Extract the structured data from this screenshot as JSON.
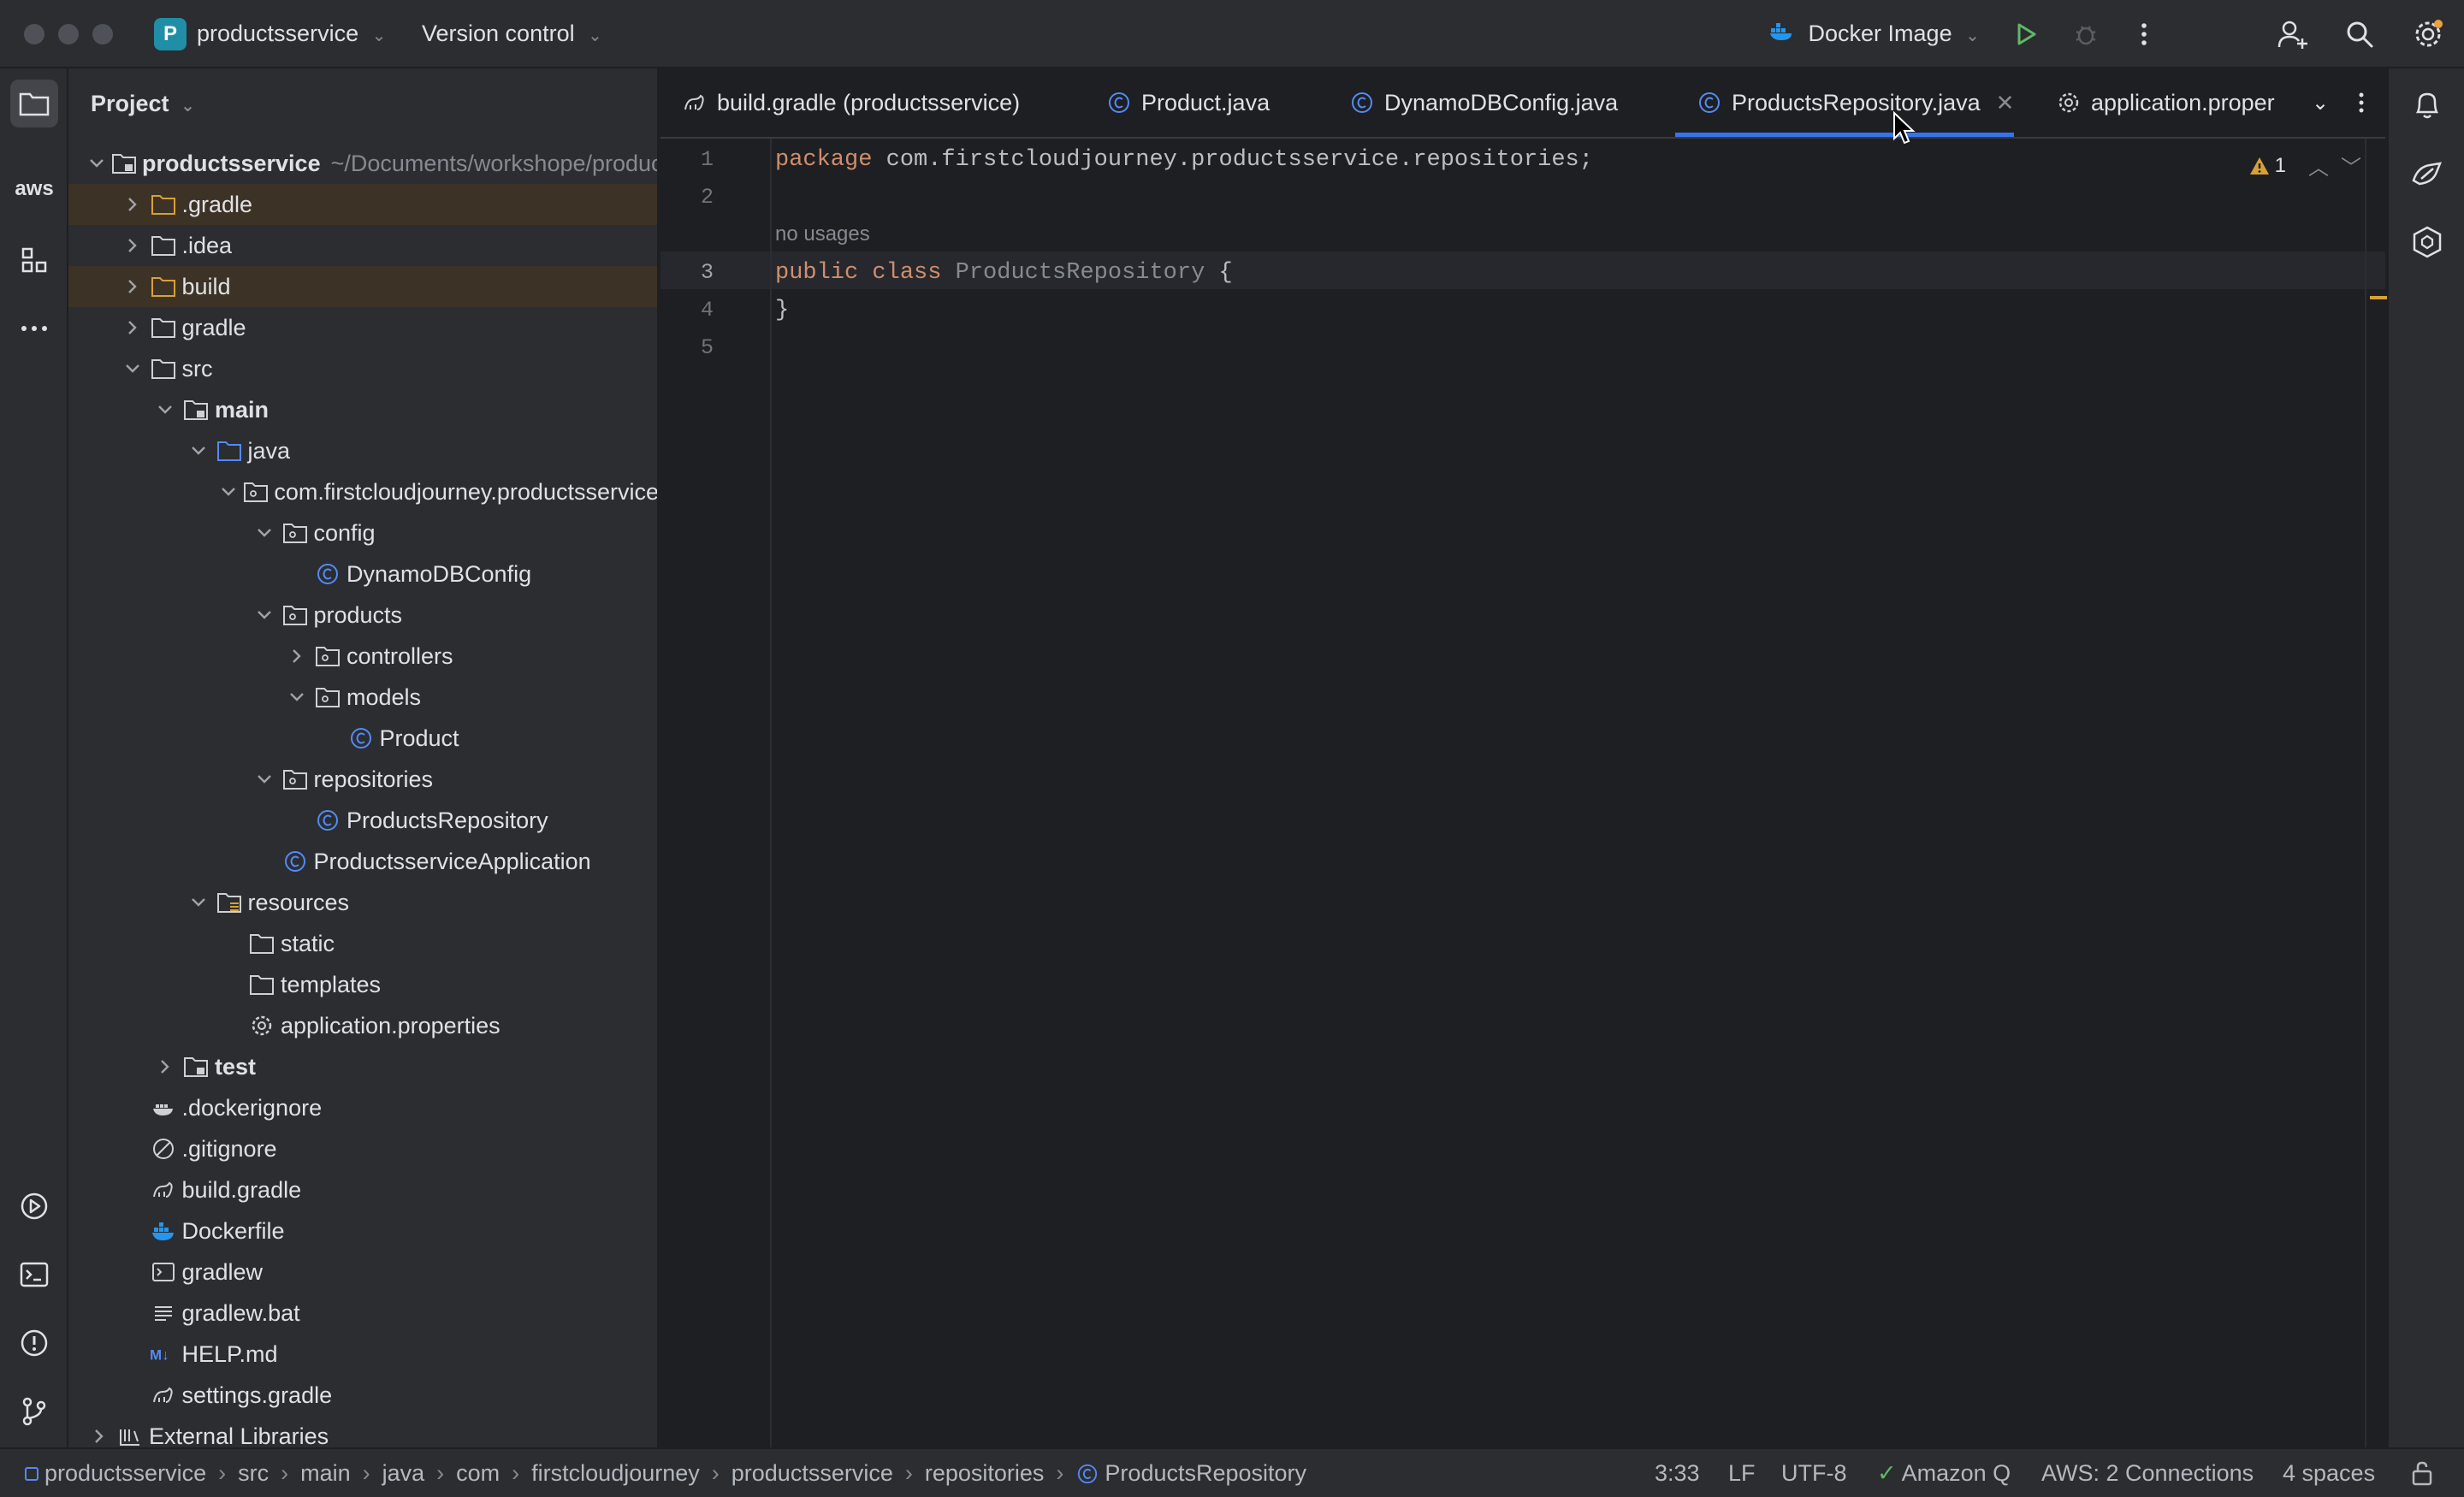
{
  "titlebar": {
    "project_badge": "P",
    "project_name": "productsservice",
    "vcs_label": "Version control",
    "run_config": "Docker Image"
  },
  "left_strip": [
    "folder-icon",
    "aws-icon",
    "structure-icon",
    "more-icon",
    "run-icon",
    "terminal-icon",
    "problems-icon",
    "git-icon"
  ],
  "left_strip_aws_label": "aws",
  "project_panel": {
    "title": "Project",
    "tree": [
      {
        "label": "productsservice",
        "hint": "~/Documents/workshope/products",
        "indent": 0,
        "chev": "down",
        "icon": "module-folder",
        "bold": true,
        "excluded": false
      },
      {
        "label": ".gradle",
        "indent": 1,
        "chev": "right",
        "icon": "folder-excluded",
        "excluded": true
      },
      {
        "label": ".idea",
        "indent": 1,
        "chev": "right",
        "icon": "folder",
        "excluded": false
      },
      {
        "label": "build",
        "indent": 1,
        "chev": "right",
        "icon": "folder-excluded",
        "excluded": true
      },
      {
        "label": "gradle",
        "indent": 1,
        "chev": "right",
        "icon": "folder",
        "excluded": false
      },
      {
        "label": "src",
        "indent": 1,
        "chev": "down",
        "icon": "folder",
        "excluded": false
      },
      {
        "label": "main",
        "indent": 2,
        "chev": "down",
        "icon": "module-folder",
        "bold": true,
        "excluded": false
      },
      {
        "label": "java",
        "indent": 3,
        "chev": "down",
        "icon": "source-folder",
        "excluded": false
      },
      {
        "label": "com.firstcloudjourney.productsservice",
        "indent": 4,
        "chev": "down",
        "icon": "package",
        "excluded": false
      },
      {
        "label": "config",
        "indent": 5,
        "chev": "down",
        "icon": "package",
        "excluded": false
      },
      {
        "label": "DynamoDBConfig",
        "indent": 6,
        "chev": "none",
        "icon": "class",
        "excluded": false
      },
      {
        "label": "products",
        "indent": 5,
        "chev": "down",
        "icon": "package",
        "excluded": false
      },
      {
        "label": "controllers",
        "indent": 6,
        "chev": "right",
        "icon": "package",
        "excluded": false
      },
      {
        "label": "models",
        "indent": 6,
        "chev": "down",
        "icon": "package",
        "excluded": false
      },
      {
        "label": "Product",
        "indent": 7,
        "chev": "none",
        "icon": "class",
        "excluded": false
      },
      {
        "label": "repositories",
        "indent": 5,
        "chev": "down",
        "icon": "package",
        "excluded": false
      },
      {
        "label": "ProductsRepository",
        "indent": 6,
        "chev": "none",
        "icon": "class",
        "excluded": false
      },
      {
        "label": "ProductsserviceApplication",
        "indent": 5,
        "chev": "none",
        "icon": "class",
        "excluded": false
      },
      {
        "label": "resources",
        "indent": 3,
        "chev": "down",
        "icon": "resources-folder",
        "excluded": false
      },
      {
        "label": "static",
        "indent": 4,
        "chev": "none",
        "icon": "folder",
        "excluded": false
      },
      {
        "label": "templates",
        "indent": 4,
        "chev": "none",
        "icon": "folder",
        "excluded": false
      },
      {
        "label": "application.properties",
        "indent": 4,
        "chev": "none",
        "icon": "gear",
        "excluded": false
      },
      {
        "label": "test",
        "indent": 2,
        "chev": "right",
        "icon": "module-folder",
        "bold": true,
        "excluded": false
      },
      {
        "label": ".dockerignore",
        "indent": 1,
        "chev": "none",
        "icon": "docker-gray",
        "excluded": false
      },
      {
        "label": ".gitignore",
        "indent": 1,
        "chev": "none",
        "icon": "ignore",
        "excluded": false
      },
      {
        "label": "build.gradle",
        "indent": 1,
        "chev": "none",
        "icon": "gradle",
        "excluded": false
      },
      {
        "label": "Dockerfile",
        "indent": 1,
        "chev": "none",
        "icon": "docker",
        "excluded": false
      },
      {
        "label": "gradlew",
        "indent": 1,
        "chev": "none",
        "icon": "shell",
        "excluded": false
      },
      {
        "label": "gradlew.bat",
        "indent": 1,
        "chev": "none",
        "icon": "text",
        "excluded": false
      },
      {
        "label": "HELP.md",
        "indent": 1,
        "chev": "none",
        "icon": "markdown",
        "excluded": false
      },
      {
        "label": "settings.gradle",
        "indent": 1,
        "chev": "none",
        "icon": "gradle",
        "excluded": false
      },
      {
        "label": "External Libraries",
        "indent": 0,
        "chev": "right",
        "icon": "library",
        "excluded": false
      }
    ]
  },
  "tabs": [
    {
      "label": "build.gradle (productsservice)",
      "icon": "gradle",
      "active": false
    },
    {
      "label": "Product.java",
      "icon": "class",
      "active": false
    },
    {
      "label": "DynamoDBConfig.java",
      "icon": "class",
      "active": false
    },
    {
      "label": "ProductsRepository.java",
      "icon": "class",
      "active": true
    },
    {
      "label": "application.proper",
      "icon": "gear",
      "active": false
    }
  ],
  "editor": {
    "line_numbers": [
      "1",
      "2",
      "3",
      "4",
      "5"
    ],
    "package_kw": "package",
    "package_name": " com.firstcloudjourney.productsservice.repositories;",
    "usage_hint": "no usages",
    "public_kw": "public",
    "class_kw": "class",
    "class_name": "ProductsRepository",
    "open_brace": " {",
    "close_brace": "}",
    "warning_count": "1",
    "current_line": "3"
  },
  "right_strip": [
    "notifications-icon",
    "amazonq-icon",
    "plugin-icon"
  ],
  "statusbar": {
    "breadcrumbs": [
      "productsservice",
      "src",
      "main",
      "java",
      "com",
      "firstcloudjourney",
      "productsservice",
      "repositories",
      "ProductsRepository"
    ],
    "position": "3:33",
    "line_ending": "LF",
    "encoding": "UTF-8",
    "amazon_q": "Amazon Q",
    "aws": "AWS: 2 Connections",
    "indent": "4 spaces"
  },
  "colors": {
    "accent": "#3574f0",
    "keyword": "#cf8e6d",
    "warning": "#d8a037",
    "run": "#5fb865"
  }
}
